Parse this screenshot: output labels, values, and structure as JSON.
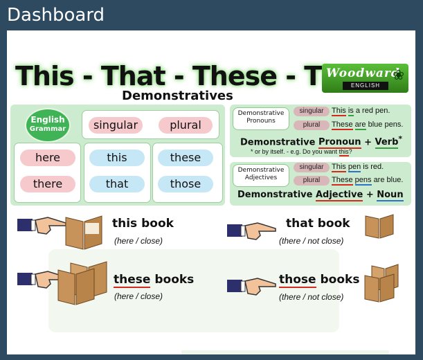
{
  "window": {
    "title": "Dashboard"
  },
  "poster": {
    "title": "This - That - These - Those",
    "subtitle": "Demonstratives",
    "logo": {
      "name": "Woodward",
      "sub": "ENGLISH"
    },
    "badge": {
      "line1": "English",
      "line2": "Grammar"
    },
    "headers": [
      "singular",
      "plural"
    ],
    "rows": [
      {
        "place": "here",
        "singular": "this",
        "plural": "these"
      },
      {
        "place": "there",
        "singular": "that",
        "plural": "those"
      }
    ],
    "pronouns": {
      "label": "Demonstrative Pronouns",
      "singular_tag": "singular",
      "plural_tag": "plural",
      "ex1_a": "This",
      "ex1_b": "is",
      "ex1_c": "a red pen.",
      "ex2_a": "These",
      "ex2_b": "are",
      "ex2_c": "blue pens.",
      "formula_a": "Demonstrative",
      "formula_b": "Pronoun",
      "formula_c": "+",
      "formula_d": "Verb",
      "formula_star": "*",
      "note_a": "* or by itself.   - e.g. Do you want ",
      "note_b": "this",
      "note_c": "?"
    },
    "adjectives": {
      "label": "Demonstrative Adjectives",
      "singular_tag": "singular",
      "plural_tag": "plural",
      "ex1_a": "This",
      "ex1_b": "pen",
      "ex1_c": "is red.",
      "ex2_a": "These",
      "ex2_b": "pens",
      "ex2_c": "are blue.",
      "formula_a": "Demonstrative",
      "formula_b": "Adjective",
      "formula_c": "+",
      "formula_d": "Noun"
    },
    "examples": [
      {
        "word": "this",
        "noun": "book",
        "hint": "(here / close)"
      },
      {
        "word": "that",
        "noun": "book",
        "hint": "(there / not close)"
      },
      {
        "word": "these",
        "noun": "books",
        "hint": "(here / close)"
      },
      {
        "word": "those",
        "noun": "books",
        "hint": "(there / not close)"
      }
    ],
    "book_cover": "Woodward English",
    "icons": {
      "hand": "pointing-hand-icon",
      "book": "open-book-icon",
      "fern": "fern-icon"
    }
  }
}
